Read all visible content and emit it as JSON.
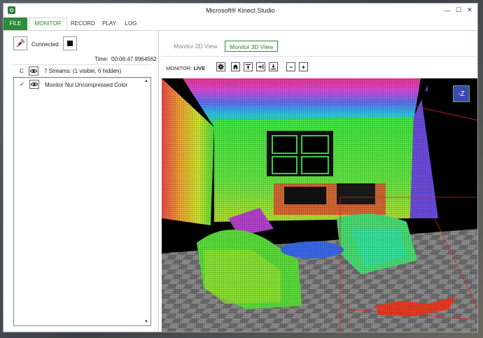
{
  "window": {
    "title": "Microsoft® Kinect Studio",
    "minimize": "—",
    "maximize": "☐",
    "close": "✕"
  },
  "menu": {
    "file": "FILE",
    "monitor": "MONITOR",
    "record": "RECORD",
    "play": "PLAY",
    "log": "LOG"
  },
  "left": {
    "connection_label": "Connected",
    "time_label": "Time:",
    "time_value": "00:06:47.9964562",
    "streams_c": "C",
    "streams_text": "7 Streams: (1 visible, 6 hidden)",
    "stream_items": [
      {
        "check": "✓",
        "name": "Monitor Nui Uncompressed Color"
      }
    ]
  },
  "main": {
    "tabs": {
      "view2d": "Monitor 2D View",
      "view3d": "Monitor 3D View"
    },
    "toolbar": {
      "label": "MONITOR:",
      "status": "LIVE",
      "zoom_out": "−",
      "zoom_in": "+"
    },
    "axis_label": "-Z"
  },
  "icons": [
    "plug-icon",
    "stop-icon",
    "eye-icon",
    "gear-icon",
    "home-icon",
    "align-top-icon",
    "align-right-icon",
    "download-icon"
  ]
}
